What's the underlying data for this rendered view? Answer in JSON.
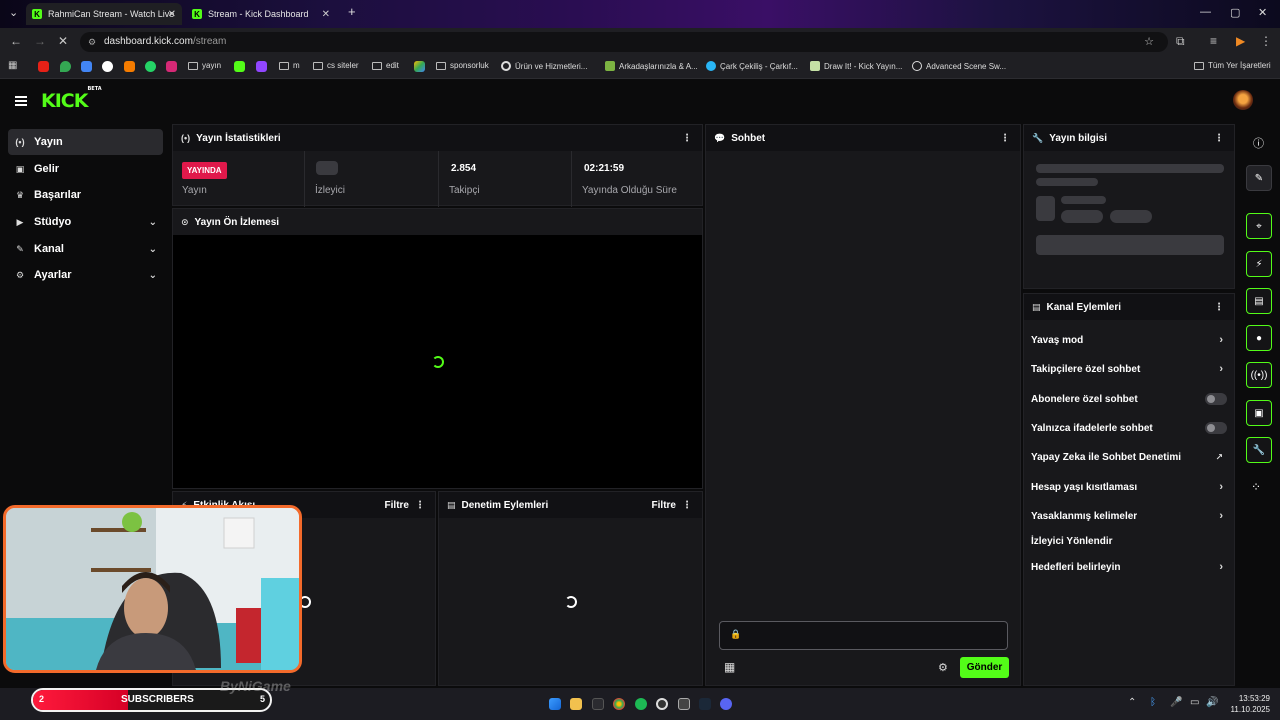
{
  "browser": {
    "tabs": [
      {
        "title": "RahmiCan Stream - Watch Live",
        "active": true
      },
      {
        "title": "Stream - Kick Dashboard",
        "active": false
      }
    ],
    "url_host": "dashboard.kick.com",
    "url_path": "/stream",
    "bookmarks": [
      "yayın",
      "m",
      "cs siteler",
      "edit",
      "sponsorluk",
      "Ürün ve Hizmetleri...",
      "Arkadaşlarınızla & A...",
      "Çark Çekiliş - Çarkıf...",
      "Draw It! - Kick Yayın...",
      "Advanced Scene Sw..."
    ],
    "all_bookmarks": "Tüm Yer İşaretleri"
  },
  "kick": {
    "logo": "KICK",
    "logo_badge": "BETA",
    "accent": "#53fc18"
  },
  "sidebar": {
    "items": [
      {
        "label": "Yayın",
        "icon": "broadcast-icon",
        "glyph": "(•)",
        "active": true,
        "expandable": false
      },
      {
        "label": "Gelir",
        "icon": "wallet-icon",
        "glyph": "▣",
        "active": false,
        "expandable": false
      },
      {
        "label": "Başarılar",
        "icon": "trophy-icon",
        "glyph": "🏆",
        "active": false,
        "expandable": false
      },
      {
        "label": "Stüdyo",
        "icon": "studio-icon",
        "glyph": "🎥",
        "active": false,
        "expandable": true
      },
      {
        "label": "Kanal",
        "icon": "channel-icon",
        "glyph": "✎",
        "active": false,
        "expandable": true
      },
      {
        "label": "Ayarlar",
        "icon": "gear-icon",
        "glyph": "⚙",
        "active": false,
        "expandable": true
      }
    ]
  },
  "stats_panel": {
    "title": "Yayın İstatistikleri",
    "live_badge": "YAYINDA",
    "stats": [
      {
        "label": "Yayın",
        "value": ""
      },
      {
        "label": "İzleyici",
        "value": ""
      },
      {
        "label": "Takipçi",
        "value": "2.854"
      },
      {
        "label": "Yayında Olduğu Süre",
        "value": "02:21:59"
      }
    ]
  },
  "preview_panel": {
    "title": "Yayın Ön İzlemesi"
  },
  "activity_panel": {
    "title": "Etkinlik Akışı",
    "filter": "Filtre"
  },
  "mod_panel": {
    "title": "Denetim Eylemleri",
    "filter": "Filtre"
  },
  "chat_panel": {
    "title": "Sohbet",
    "send": "Gönder",
    "input_value": ""
  },
  "info_panel": {
    "title": "Yayın bilgisi"
  },
  "channel_actions": {
    "title": "Kanal Eylemleri",
    "items": [
      {
        "label": "Yavaş mod",
        "control": "chevron"
      },
      {
        "label": "Takipçilere özel sohbet",
        "control": "chevron"
      },
      {
        "label": "Abonelere özel sohbet",
        "control": "toggle"
      },
      {
        "label": "Yalnızca ifadelerle sohbet",
        "control": "toggle"
      },
      {
        "label": "Yapay Zeka ile Sohbet Denetimi",
        "control": "external"
      },
      {
        "label": "Hesap yaşı kısıtlaması",
        "control": "chevron"
      },
      {
        "label": "Yasaklanmış kelimeler",
        "control": "chevron"
      },
      {
        "label": "İzleyici Yönlendir",
        "control": "none"
      },
      {
        "label": "Hedefleri belirleyin",
        "control": "chevron"
      }
    ]
  },
  "right_rail": [
    "info-icon",
    "pencil-icon",
    "scan-icon",
    "bolt-icon",
    "document-icon",
    "chat-icon",
    "broadcast-icon",
    "layout-icon",
    "wrench-icon",
    "apps-icon"
  ],
  "overlay": {
    "subs_left": "2",
    "subs_label": "SUBSCRIBERS",
    "subs_right": "5",
    "subs_progress": 0.4,
    "watermark": "ByNiGame"
  },
  "taskbar": {
    "time": "13:53:29",
    "date": "11.10.2025"
  }
}
